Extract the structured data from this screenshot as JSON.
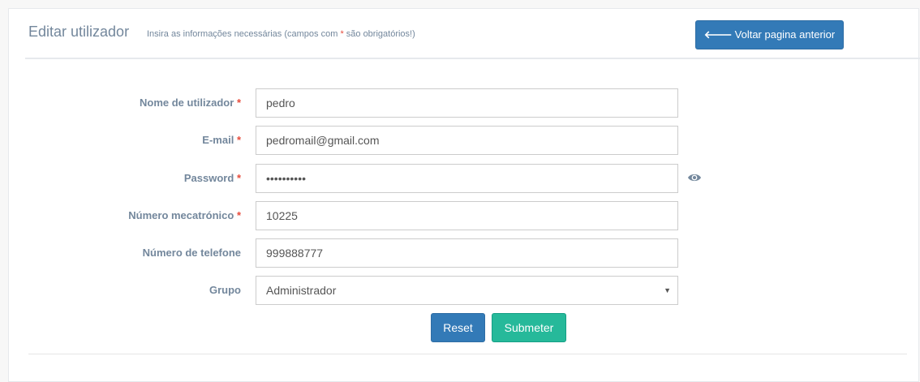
{
  "header": {
    "title": "Editar utilizador",
    "subtitle_pre": "Insira as informações necessárias (campos com ",
    "subtitle_star": "*",
    "subtitle_post": " são obrigatórios!)",
    "back_button_label": "Voltar pagina anterior",
    "back_icon": "arrow-left-icon"
  },
  "form": {
    "required_marker": "*",
    "fields": [
      {
        "label": "Nome de utilizador",
        "required": true,
        "value": "pedro"
      },
      {
        "label": "E-mail",
        "required": true,
        "value": "pedromail@gmail.com"
      },
      {
        "label": "Password",
        "required": true,
        "value": "••••••••••",
        "toggle_icon": "eye-icon"
      },
      {
        "label": "Número mecatrónico",
        "required": true,
        "value": "10225"
      },
      {
        "label": "Número de telefone",
        "required": false,
        "value": "999888777"
      },
      {
        "label": "Grupo",
        "required": false,
        "value": "Administrador"
      }
    ],
    "caret": "▼"
  },
  "actions": {
    "reset_label": "Reset",
    "submit_label": "Submeter"
  },
  "colors": {
    "primary": "#337ab7",
    "success": "#26b99a",
    "required": "#e74c3c",
    "text": "#73879c"
  }
}
